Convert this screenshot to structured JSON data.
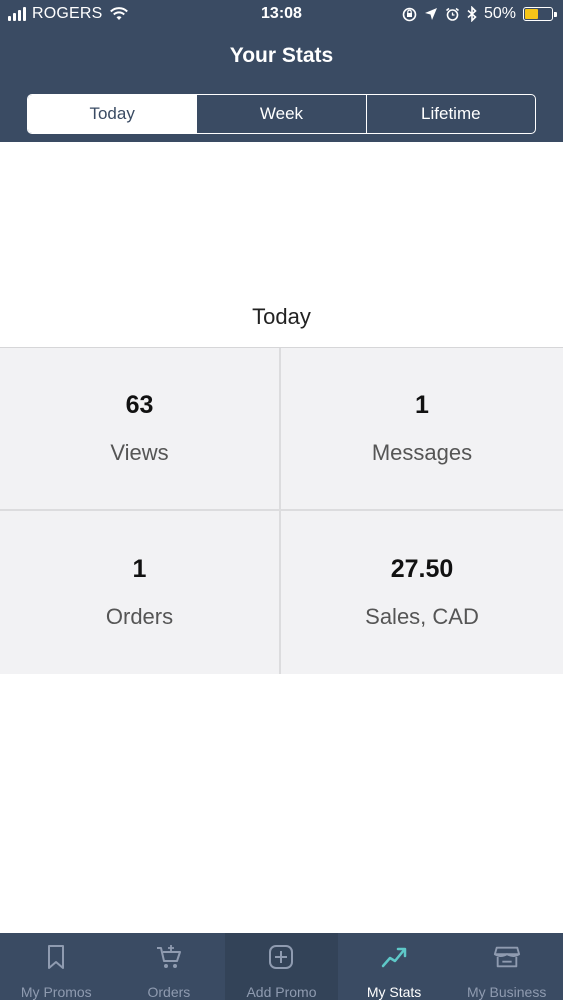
{
  "status_bar": {
    "carrier": "ROGERS",
    "time": "13:08",
    "battery_percent": "50%",
    "battery_level": 0.5,
    "battery_color": "#f5c518"
  },
  "header": {
    "title": "Your Stats",
    "background_color": "#3a4b63",
    "segments": [
      {
        "label": "Today",
        "selected": true
      },
      {
        "label": "Week",
        "selected": false
      },
      {
        "label": "Lifetime",
        "selected": false
      }
    ]
  },
  "period_label": "Today",
  "stats": [
    {
      "value": "63",
      "label": "Views"
    },
    {
      "value": "1",
      "label": "Messages"
    },
    {
      "value": "1",
      "label": "Orders"
    },
    {
      "value": "27.50",
      "label": "Sales, CAD"
    }
  ],
  "tab_bar": {
    "items": [
      {
        "label": "My Promos",
        "icon": "bookmark-icon",
        "active": false
      },
      {
        "label": "Orders",
        "icon": "cart-icon",
        "active": false
      },
      {
        "label": "Add Promo",
        "icon": "plus-square-icon",
        "active": false
      },
      {
        "label": "My Stats",
        "icon": "trend-up-icon",
        "active": true
      },
      {
        "label": "My Business",
        "icon": "store-icon",
        "active": false
      }
    ],
    "active_color": "#5ec8c8"
  }
}
